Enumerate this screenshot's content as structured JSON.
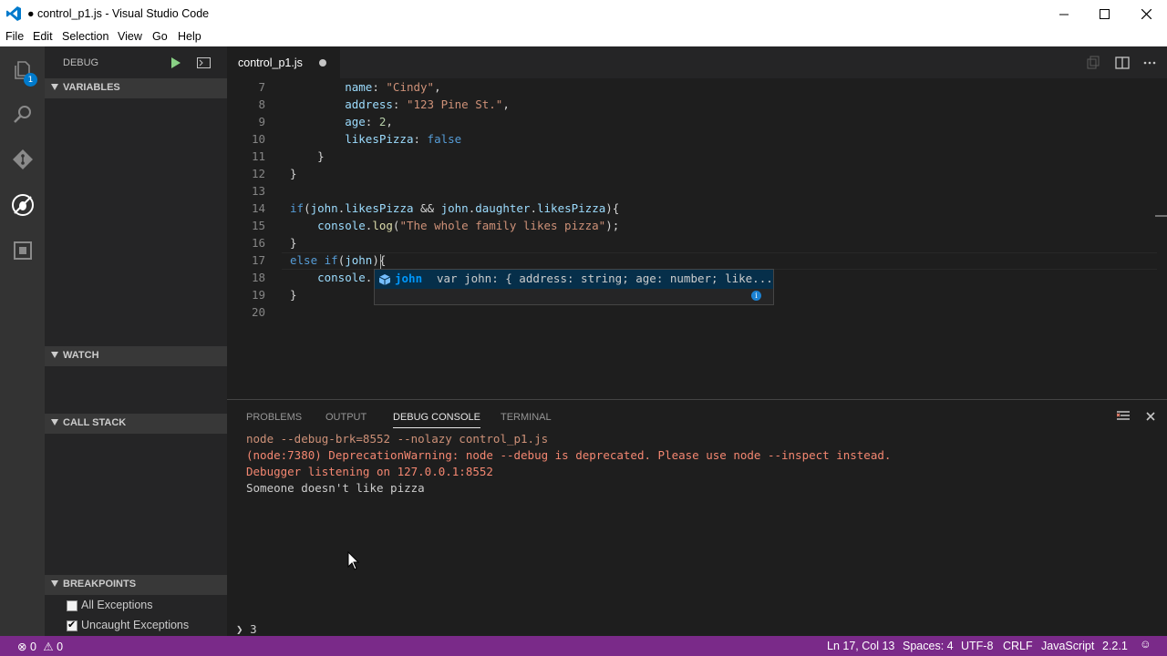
{
  "window": {
    "title": "● control_p1.js - Visual Studio Code"
  },
  "menu": [
    "File",
    "Edit",
    "Selection",
    "View",
    "Go",
    "Help"
  ],
  "activity": {
    "explorer_badge": "1"
  },
  "sidebar": {
    "title": "DEBUG",
    "sections": {
      "variables": "VARIABLES",
      "watch": "WATCH",
      "call_stack": "CALL STACK",
      "breakpoints": "BREAKPOINTS"
    },
    "breakpoints": [
      {
        "label": "All Exceptions",
        "checked": false
      },
      {
        "label": "Uncaught Exceptions",
        "checked": true
      }
    ]
  },
  "editor": {
    "tab": "control_p1.js",
    "line_numbers": [
      "7",
      "8",
      "9",
      "10",
      "11",
      "12",
      "13",
      "14",
      "15",
      "16",
      "17",
      "18",
      "19",
      "20"
    ],
    "suggestion": {
      "label": "john",
      "detail": "var john: { address: string; age: number; like..."
    }
  },
  "panel": {
    "tabs": [
      "PROBLEMS",
      "OUTPUT",
      "DEBUG CONSOLE",
      "TERMINAL"
    ],
    "active_tab": "DEBUG CONSOLE",
    "lines": [
      "node --debug-brk=8552 --nolazy control_p1.js",
      "(node:7380) DeprecationWarning: node --debug is deprecated. Please use node --inspect instead.",
      "Debugger listening on 127.0.0.1:8552",
      "Someone doesn't like pizza"
    ],
    "prompt_value": "3"
  },
  "status": {
    "errors": "0",
    "warnings": "0",
    "position": "Ln 17, Col 13",
    "spaces": "Spaces: 4",
    "encoding": "UTF-8",
    "eol": "CRLF",
    "language": "JavaScript",
    "version": "2.2.1"
  },
  "colors": {
    "statusbar": "#7a2a89",
    "activitybar": "#333333",
    "sidebar": "#252526",
    "editor": "#1e1e1e",
    "accent": "#007acc"
  }
}
